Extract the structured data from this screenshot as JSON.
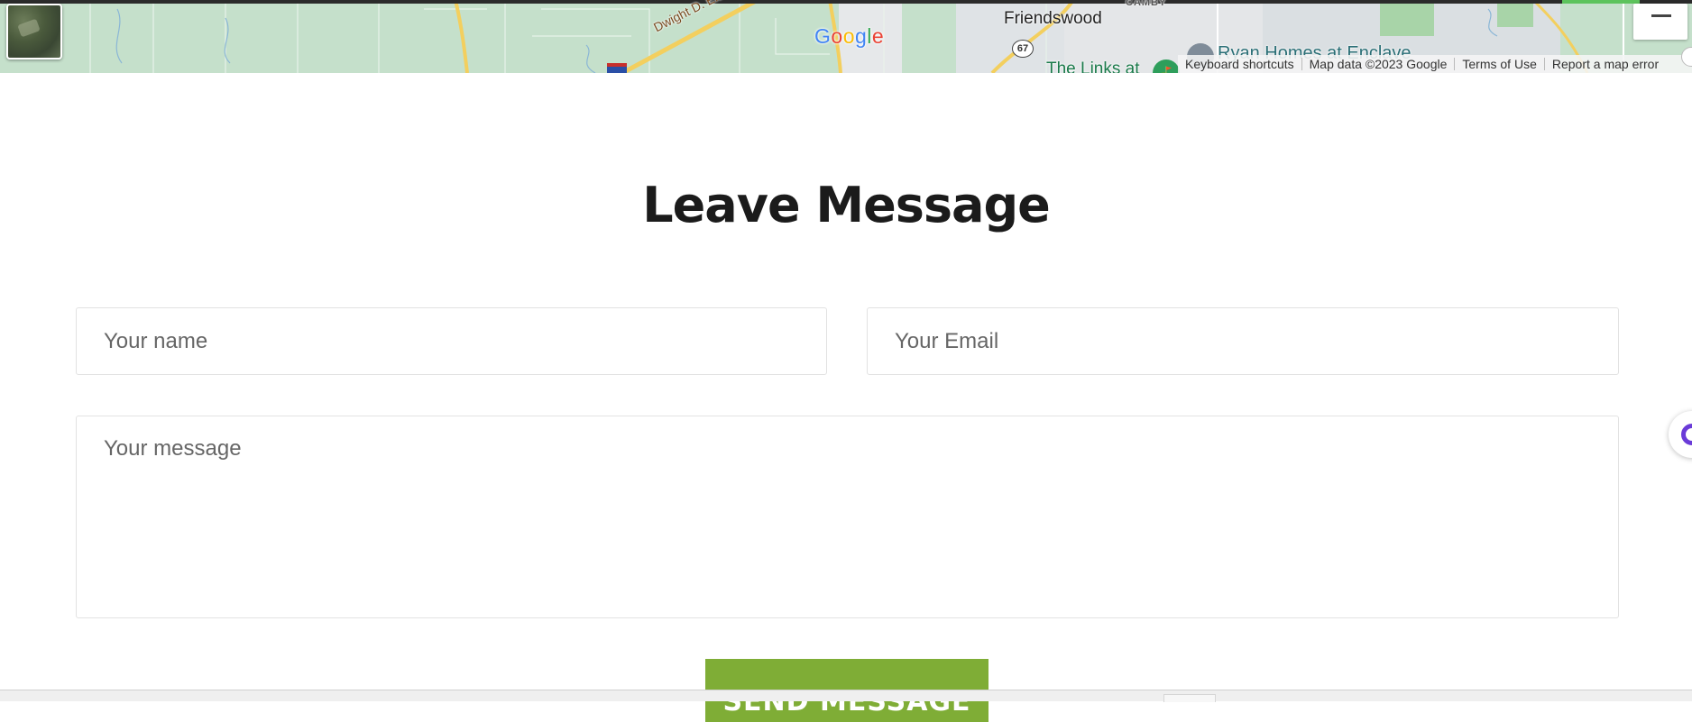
{
  "map": {
    "labels": {
      "friendswood": "Friendswood",
      "camby": "CAMBY",
      "dwight": "Dwight D. Eisenho",
      "ryan_homes": "Ryan Homes at Enclave",
      "links_at": "The Links at",
      "route_67": "67"
    },
    "google_logo": [
      "G",
      "o",
      "o",
      "g",
      "l",
      "e"
    ],
    "footer": {
      "keyboard_shortcuts": "Keyboard shortcuts",
      "map_data": "Map data ©2023 Google",
      "terms": "Terms of Use",
      "report": "Report a map error"
    },
    "icons": {
      "satellite_toggle": "satellite-thumbnail-icon",
      "fullscreen": "minus-icon",
      "poi": "golf-poi-icon",
      "interstate": "interstate-shield-icon"
    }
  },
  "form": {
    "title": "Leave Message",
    "name_placeholder": "Your name",
    "email_placeholder": "Your Email",
    "message_placeholder": "Your message",
    "submit_label": "SEND MESSAGE"
  },
  "colors": {
    "accent": "#7fad36",
    "map_green": "#c9e3cf",
    "chat_widget": "#6a3bd8"
  }
}
